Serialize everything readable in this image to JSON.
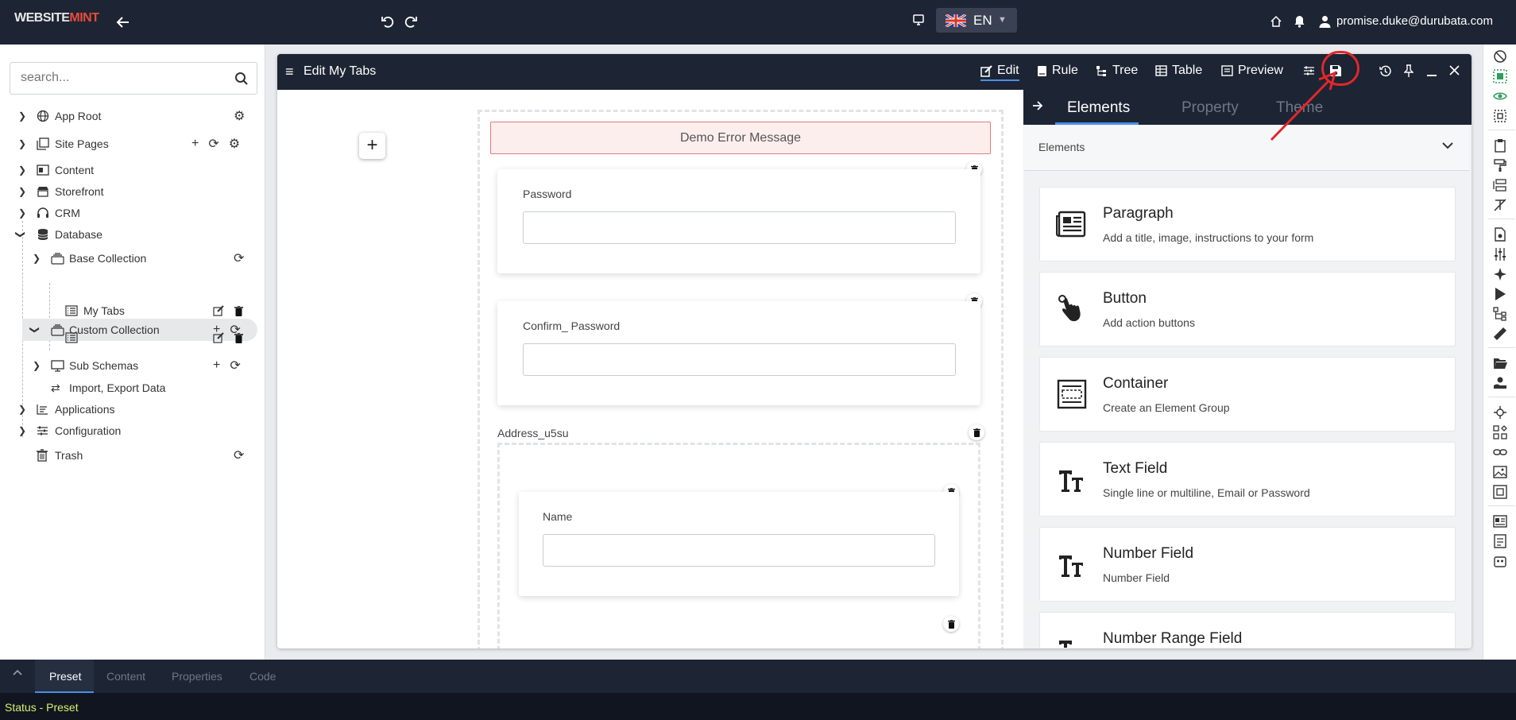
{
  "app": {
    "logo_part1": "WEBSITE",
    "logo_part2": "MINT",
    "language": "EN",
    "user_email": "promise.duke@durubata.com"
  },
  "sidebar": {
    "search_placeholder": "search...",
    "items": [
      {
        "label": "App Root"
      },
      {
        "label": "Site Pages"
      },
      {
        "label": "Content"
      },
      {
        "label": "Storefront"
      },
      {
        "label": "CRM"
      },
      {
        "label": "Database"
      },
      {
        "label": "Base Collection"
      },
      {
        "label": "Custom Collection"
      },
      {
        "label": "My Tabs"
      },
      {
        "label": ""
      },
      {
        "label": "Sub Schemas"
      },
      {
        "label": "Import, Export Data"
      },
      {
        "label": "Applications"
      },
      {
        "label": "Configuration"
      },
      {
        "label": "Trash"
      }
    ]
  },
  "editor": {
    "title": "Edit My Tabs",
    "modes": [
      "Edit",
      "Rule",
      "Tree",
      "Table",
      "Preview"
    ],
    "active_mode": "Edit"
  },
  "form": {
    "error_message": "Demo Error Message",
    "password_label": "Password",
    "confirm_password_label": "Confirm_ Password",
    "address_label": "Address_u5su",
    "name_label": "Name"
  },
  "elements_panel": {
    "tabs": [
      "Elements",
      "Property",
      "Theme"
    ],
    "active_tab": "Elements",
    "section_title": "Elements",
    "items": [
      {
        "title": "Paragraph",
        "desc": "Add a title, image, instructions to your form",
        "icon": "newspaper-icon"
      },
      {
        "title": "Button",
        "desc": "Add action buttons",
        "icon": "pointer-hand-icon"
      },
      {
        "title": "Container",
        "desc": "Create an Element Group",
        "icon": "container-icon"
      },
      {
        "title": "Text Field",
        "desc": "Single line or multiline, Email or Password",
        "icon": "text-size-icon"
      },
      {
        "title": "Number Field",
        "desc": "Number Field",
        "icon": "text-size-icon"
      },
      {
        "title": "Number Range Field",
        "desc": "",
        "icon": "text-size-icon"
      }
    ]
  },
  "bottom": {
    "tabs": [
      "Preset",
      "Content",
      "Properties",
      "Code"
    ],
    "active_tab": "Preset",
    "status": "Status - Preset"
  },
  "colors": {
    "topbar": "#1d2433",
    "accent": "#4a8fe6",
    "error_bg": "#fdeeee",
    "error_border": "#e07b7b",
    "annotation_red": "#e0282b",
    "status_text": "#d7f06e"
  }
}
